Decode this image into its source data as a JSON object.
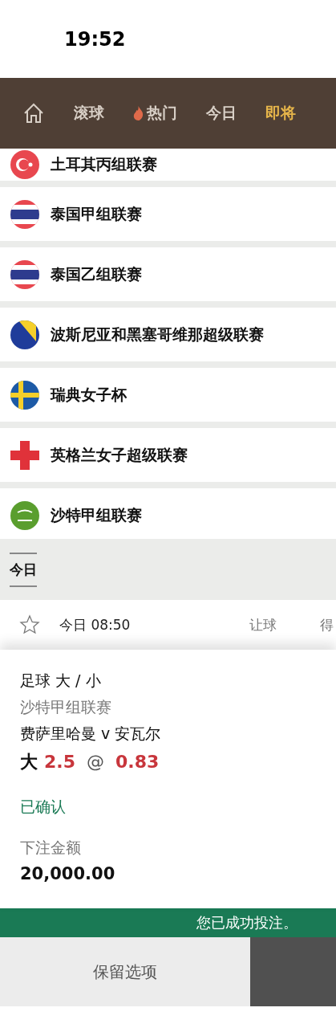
{
  "status_bar": {
    "time": "19:52"
  },
  "nav": {
    "tabs": [
      {
        "kind": "home",
        "selected": false
      },
      {
        "kind": "text",
        "label": "滚球",
        "selected": false
      },
      {
        "kind": "hot",
        "label": "热门",
        "selected": false
      },
      {
        "kind": "text",
        "label": "今日",
        "selected": false
      },
      {
        "kind": "text",
        "label": "即将",
        "selected": true
      }
    ]
  },
  "leagues": [
    {
      "name": "土耳其丙组联赛"
    },
    {
      "name": "泰国甲组联赛"
    },
    {
      "name": "泰国乙组联赛"
    },
    {
      "name": "波斯尼亚和黑塞哥维那超级联赛"
    },
    {
      "name": "瑞典女子杯"
    },
    {
      "name": "英格兰女子超级联赛"
    },
    {
      "name": "沙特甲组联赛"
    }
  ],
  "section": {
    "tab": "今日"
  },
  "match": {
    "time": "今日 08:50",
    "column_1": "让球",
    "column_2": "得"
  },
  "bet_slip": {
    "market": "足球 大 / 小",
    "league": "沙特甲组联赛",
    "teams": "费萨里哈曼 v 安瓦尔",
    "selection": "大",
    "line": "2.5",
    "at": "@",
    "odds": "0.83",
    "status": "已确认",
    "stake_label": "下注金额",
    "stake": "20,000.00"
  },
  "toast": "您已成功投注。",
  "actions": {
    "keep": "保留选项"
  }
}
